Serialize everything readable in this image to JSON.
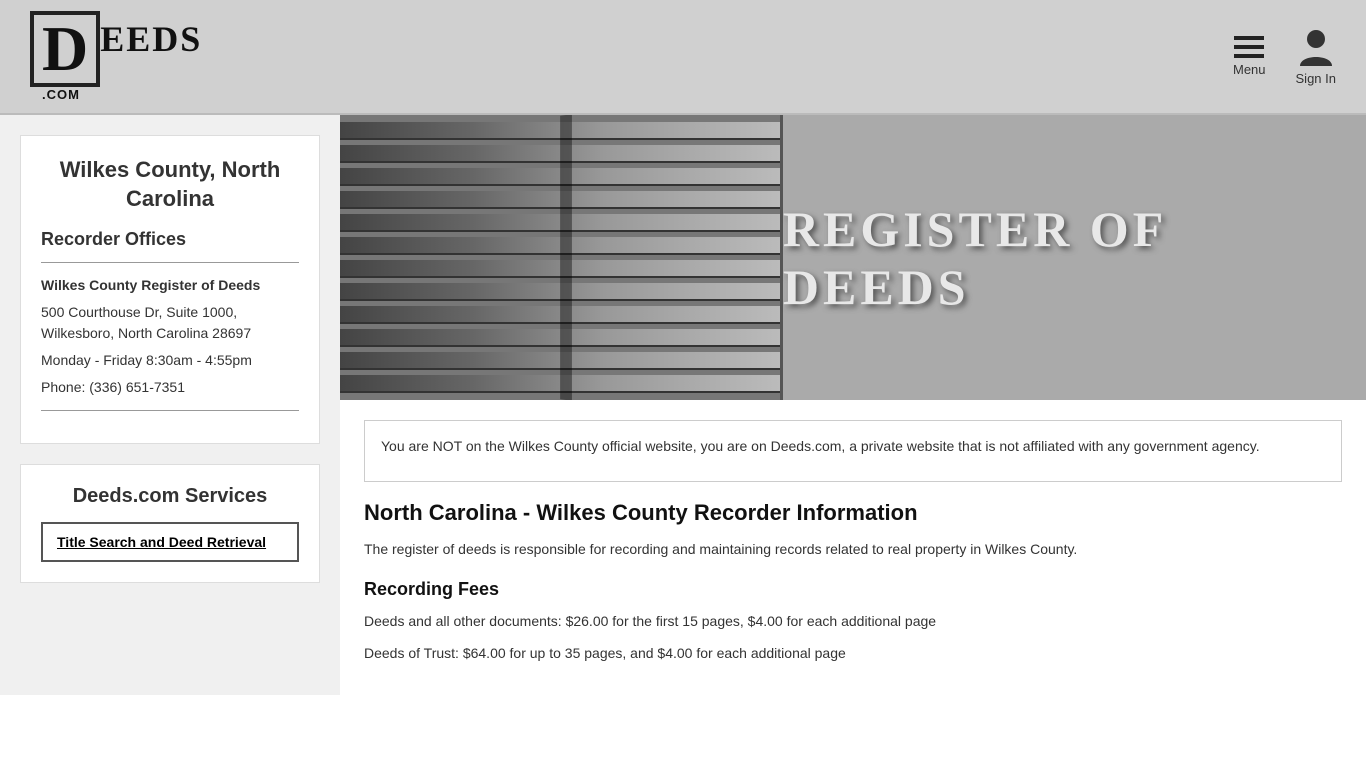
{
  "header": {
    "logo_d": "D",
    "logo_eeds": "EEDS",
    "logo_com": ".COM",
    "menu_label": "Menu",
    "signin_label": "Sign In"
  },
  "sidebar": {
    "county_title": "Wilkes County, North Carolina",
    "recorder_heading": "Recorder Offices",
    "office_name": "Wilkes County Register of Deeds",
    "address": "500 Courthouse Dr, Suite 1000, Wilkesboro, North Carolina 28697",
    "hours": "Monday - Friday 8:30am - 4:55pm",
    "phone": "Phone: (336) 651-7351",
    "services_title": "Deeds.com Services",
    "service_link": "Title Search and Deed Retrieval"
  },
  "hero": {
    "sign_text": "REGISTER OF DEEDS"
  },
  "content": {
    "disclaimer": "You are NOT on the Wilkes County official website, you are on Deeds.com, a private website that is not affiliated with any government agency.",
    "main_heading": "North Carolina - Wilkes County Recorder Information",
    "intro_text": "The register of deeds is responsible for recording and maintaining records related to real property in Wilkes County.",
    "fees_heading": "Recording Fees",
    "fee_1": "Deeds and all other documents: $26.00 for the first 15 pages, $4.00 for each additional page",
    "fee_2": "Deeds of Trust: $64.00 for up to 35 pages, and $4.00 for each additional page"
  }
}
